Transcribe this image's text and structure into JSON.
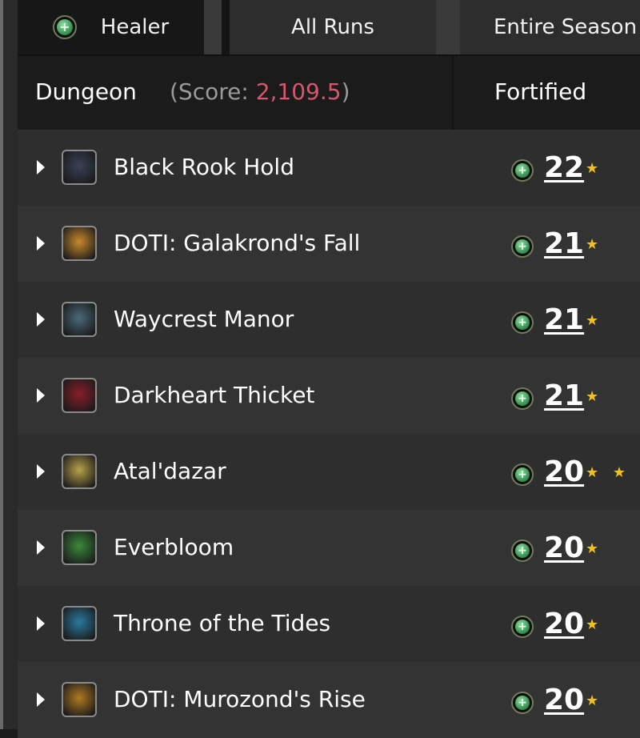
{
  "tabs": {
    "healer_label": "Healer",
    "all_runs_label": "All Runs",
    "entire_season_label": "Entire Season"
  },
  "header": {
    "dungeon_label": "Dungeon",
    "score_prefix": "(Score: ",
    "score_value": "2,109.5",
    "score_suffix": ")",
    "fortified_label": "Fortified"
  },
  "colors": {
    "score_value": "#d9566b",
    "star": "#f0c020",
    "healer_green": "#2f8a4a"
  },
  "dungeons": [
    {
      "name": "Black Rook Hold",
      "level": "22",
      "stars": "★",
      "thumb_icon": "black-rook-hold-icon",
      "thumb_color": "#3a4258"
    },
    {
      "name": "DOTI: Galakrond's Fall",
      "level": "21",
      "stars": "★",
      "thumb_icon": "galakronds-fall-icon",
      "thumb_color": "#c98a2e"
    },
    {
      "name": "Waycrest Manor",
      "level": "21",
      "stars": "★",
      "thumb_icon": "waycrest-manor-icon",
      "thumb_color": "#4a6a7a"
    },
    {
      "name": "Darkheart Thicket",
      "level": "21",
      "stars": "★",
      "thumb_icon": "darkheart-thicket-icon",
      "thumb_color": "#8a1e2a"
    },
    {
      "name": "Atal'dazar",
      "level": "20",
      "stars": "★ ★",
      "thumb_icon": "ataldazar-icon",
      "thumb_color": "#b8a24a"
    },
    {
      "name": "Everbloom",
      "level": "20",
      "stars": "★",
      "thumb_icon": "everbloom-icon",
      "thumb_color": "#3a8a3a"
    },
    {
      "name": "Throne of the Tides",
      "level": "20",
      "stars": "★",
      "thumb_icon": "throne-of-the-tides-icon",
      "thumb_color": "#2a7aa0"
    },
    {
      "name": "DOTI: Murozond's Rise",
      "level": "20",
      "stars": "★",
      "thumb_icon": "murozonds-rise-icon",
      "thumb_color": "#b07a22"
    }
  ]
}
